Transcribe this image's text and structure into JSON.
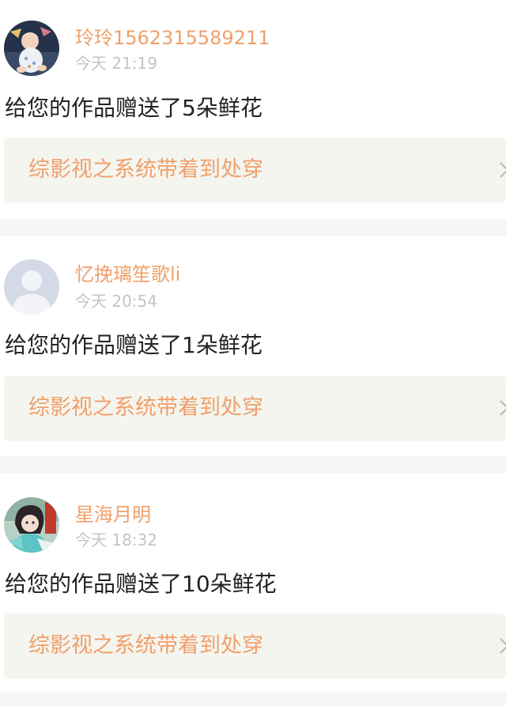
{
  "notifications": [
    {
      "username": "玲玲1562315589211",
      "time": "今天 21:19",
      "message": "给您的作品赠送了5朵鲜花",
      "work_title": "综影视之系统带着到处穿",
      "avatar_icon": "baby-photo-avatar"
    },
    {
      "username": "忆挽璃笙歌li",
      "time": "今天 20:54",
      "message": "给您的作品赠送了1朵鲜花",
      "work_title": "综影视之系统带着到处穿",
      "avatar_icon": "default-user-avatar"
    },
    {
      "username": "星海月明",
      "time": "今天 18:32",
      "message": "给您的作品赠送了10朵鲜花",
      "work_title": "综影视之系统带着到处穿",
      "avatar_icon": "costume-girl-avatar"
    }
  ],
  "colors": {
    "accent": "#f0a06a",
    "timestamp": "#c4c4c4",
    "message_text": "#222222",
    "work_box_bg": "#f5f5f0",
    "separator": "#f6f6f6"
  }
}
